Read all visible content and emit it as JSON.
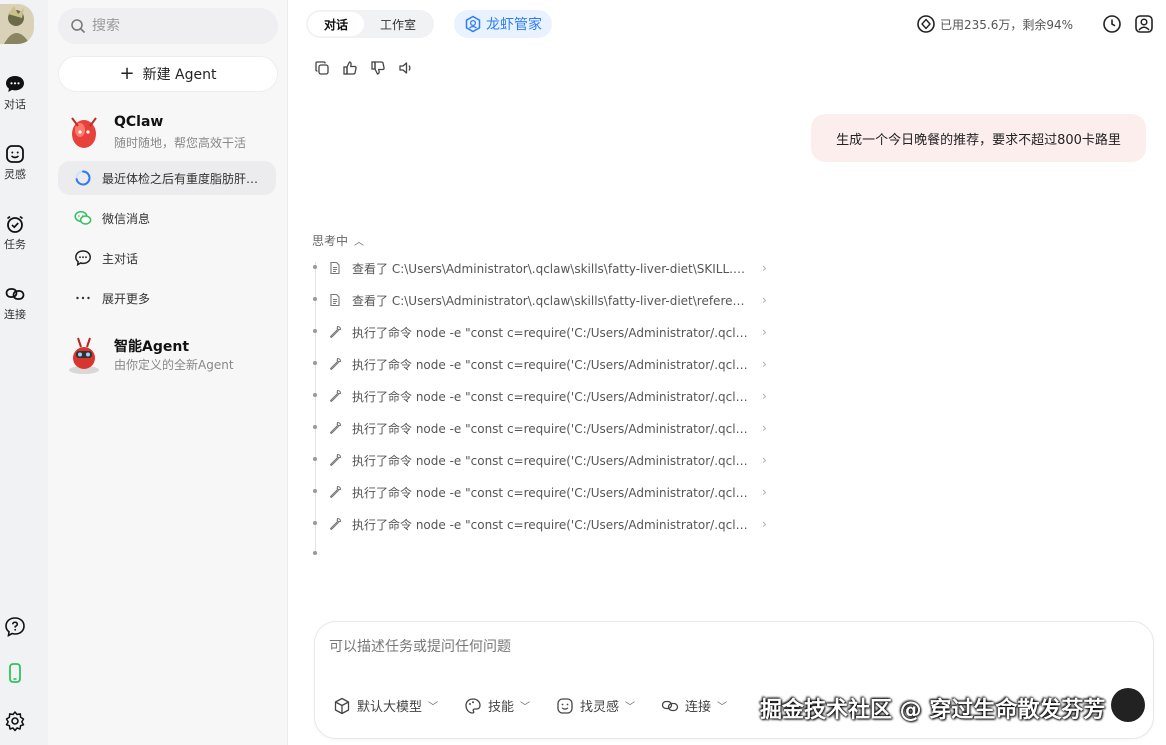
{
  "rail": {
    "items": [
      {
        "label": "对话",
        "icon": "chat-bubble-icon"
      },
      {
        "label": "灵感",
        "icon": "smile-face-icon"
      },
      {
        "label": "任务",
        "icon": "alarm-clock-icon"
      },
      {
        "label": "连接",
        "icon": "link-icon"
      }
    ],
    "bottom_icons": [
      "help-icon",
      "phone-icon",
      "settings-icon"
    ]
  },
  "sidebar": {
    "search_placeholder": "搜索",
    "new_agent_label": "新建 Agent",
    "qclaw": {
      "name": "QClaw",
      "desc": "随时随地，帮您高效干活"
    },
    "items": [
      {
        "label": "最近体检之后有重度脂肪肝…",
        "icon": "loading-spinner-icon",
        "active": true
      },
      {
        "label": "微信消息",
        "icon": "wechat-icon"
      },
      {
        "label": "主对话",
        "icon": "chat-icon"
      },
      {
        "label": "展开更多",
        "icon": "more-dots-icon"
      }
    ],
    "smart_agent": {
      "name": "智能Agent",
      "desc": "由你定义的全新Agent"
    }
  },
  "header": {
    "tabs": [
      {
        "label": "对话",
        "active": true
      },
      {
        "label": "工作室",
        "active": false
      }
    ],
    "badge_label": "龙虾管家",
    "quota_text": "已用235.6万，剩余94%"
  },
  "conversation": {
    "user_message": "生成一个今日晚餐的推荐，要求不超过800卡路里",
    "thinking_label": "思考中",
    "steps": [
      {
        "icon": "file-icon",
        "text": "查看了 C:\\Users\\Administrator\\.qclaw\\skills\\fatty-liver-diet\\SKILL.md"
      },
      {
        "icon": "file-icon",
        "text": "查看了 C:\\Users\\Administrator\\.qclaw\\skills\\fatty-liver-diet\\references\\..."
      },
      {
        "icon": "wrench-icon",
        "text": "执行了命令 node -e \"const c=require('C:/Users/Administrator/.qclaw/sk..."
      },
      {
        "icon": "wrench-icon",
        "text": "执行了命令 node -e \"const c=require('C:/Users/Administrator/.qclaw/sk..."
      },
      {
        "icon": "wrench-icon",
        "text": "执行了命令 node -e \"const c=require('C:/Users/Administrator/.qclaw/sk..."
      },
      {
        "icon": "wrench-icon",
        "text": "执行了命令 node -e \"const c=require('C:/Users/Administrator/.qclaw/sk..."
      },
      {
        "icon": "wrench-icon",
        "text": "执行了命令 node -e \"const c=require('C:/Users/Administrator/.qclaw/sk..."
      },
      {
        "icon": "wrench-icon",
        "text": "执行了命令 node -e \"const c=require('C:/Users/Administrator/.qclaw/sk..."
      },
      {
        "icon": "wrench-icon",
        "text": "执行了命令 node -e \"const c=require('C:/Users/Administrator/.qclaw/sk..."
      }
    ]
  },
  "composer": {
    "placeholder": "可以描述任务或提问任何问题",
    "tools": [
      {
        "label": "默认大模型",
        "icon": "cube-icon"
      },
      {
        "label": "技能",
        "icon": "palette-icon"
      },
      {
        "label": "找灵感",
        "icon": "smile-face-icon"
      },
      {
        "label": "连接",
        "icon": "link-icon"
      }
    ]
  },
  "watermark": "掘金技术社区 @ 穿过生命散发芬芳",
  "colors": {
    "accent": "#2f7cf6",
    "bubble": "#fdeeee",
    "rail": "#f1f2f4",
    "sidebar": "#f7f7f8"
  }
}
